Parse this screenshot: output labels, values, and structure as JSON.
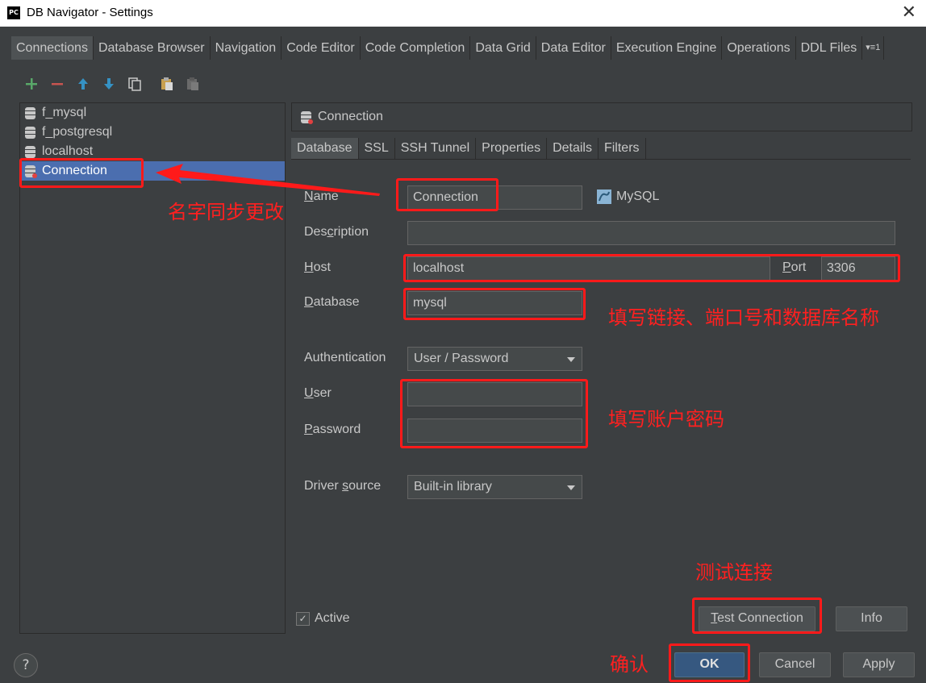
{
  "window": {
    "title": "DB Navigator - Settings",
    "app_icon_text": "PC",
    "close": "✕"
  },
  "tabs": [
    "Connections",
    "Database Browser",
    "Navigation",
    "Code Editor",
    "Code Completion",
    "Data Grid",
    "Data Editor",
    "Execution Engine",
    "Operations",
    "DDL Files"
  ],
  "tabs_more": "▾≡1",
  "toolbar": {
    "icons": [
      "add-icon",
      "remove-icon",
      "move-up-icon",
      "move-down-icon",
      "copy-icon",
      "paste-icon",
      "paste-disabled-icon"
    ]
  },
  "connections": [
    {
      "name": "f_mysql"
    },
    {
      "name": "f_postgresql"
    },
    {
      "name": "localhost"
    },
    {
      "name": "Connection",
      "selected": true
    }
  ],
  "panel": {
    "header": "Connection",
    "subtabs": [
      "Database",
      "SSL",
      "SSH Tunnel",
      "Properties",
      "Details",
      "Filters"
    ]
  },
  "form": {
    "name_label_u": "N",
    "name_label": "ame",
    "name_value": "Connection",
    "db_type": "MySQL",
    "description_label_a": "Des",
    "description_label_u": "c",
    "description_label_b": "ription",
    "description_value": "",
    "host_label_u": "H",
    "host_label": "ost",
    "host_value": "localhost",
    "port_label_u": "P",
    "port_label": "ort",
    "port_value": "3306",
    "database_label_u": "D",
    "database_label": "atabase",
    "database_value": "mysql",
    "auth_label": "Authentication",
    "auth_value": "User / Password",
    "user_label_u": "U",
    "user_label": "ser",
    "user_value": "",
    "password_label_u": "P",
    "password_label": "assword",
    "password_value": "",
    "driver_label_a": "Driver ",
    "driver_label_u": "s",
    "driver_label_b": "ource",
    "driver_value": "Built-in library",
    "active_label": "Active",
    "active_checked": "✓"
  },
  "buttons": {
    "test_u": "T",
    "test": "est Connection",
    "info": "Info",
    "ok": "OK",
    "cancel": "Cancel",
    "apply": "Apply",
    "help": "?"
  },
  "annotations": {
    "name_sync": "名字同步更改",
    "fill_host": "填写链接、端口号和数据库名称",
    "fill_account": "填写账户密码",
    "test": "测试连接",
    "confirm": "确认"
  },
  "colors": {
    "annotation": "#ff1a1a",
    "selection": "#4b6eaf",
    "background": "#3c3f41"
  }
}
